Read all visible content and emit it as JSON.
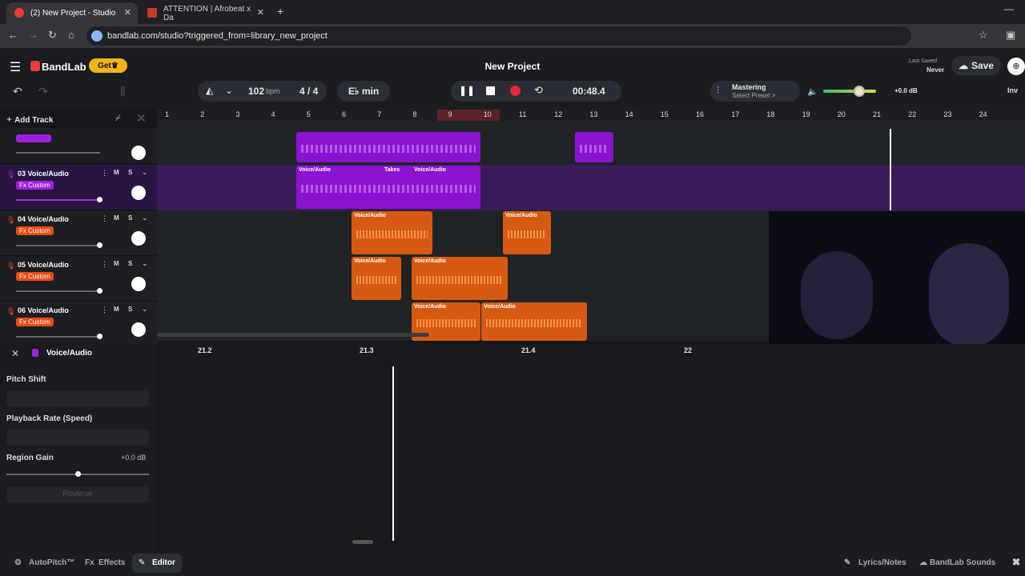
{
  "browser": {
    "tabs": [
      {
        "title": "(2) New Project - Studio"
      },
      {
        "title": "ATTENTION | Afrobeat x Da"
      }
    ],
    "url": "bandlab.com/studio?triggered_from=library_new_project"
  },
  "app": {
    "brand": "BandLab",
    "get_label": "Get",
    "project_title": "New Project",
    "last_saved_label": "Last Saved",
    "last_saved_value": "Never",
    "save_label": "Save",
    "bpm": "102",
    "bpm_unit": "bpm",
    "time_sig": "4 / 4",
    "key": "E♭ min",
    "time": "00:48.4",
    "mastering_label": "Mastering",
    "mastering_preset": "Select Preset >",
    "volume_db": "+0.0 dB",
    "add_track": "Add Track",
    "inv_label": "Inv"
  },
  "ruler": [
    "1",
    "2",
    "3",
    "4",
    "5",
    "6",
    "7",
    "8",
    "9",
    "10",
    "11",
    "12",
    "13",
    "14",
    "15",
    "16",
    "17",
    "18",
    "19",
    "20",
    "21",
    "22",
    "23",
    "24"
  ],
  "tracks": [
    {
      "name": "03 Voice/Audio",
      "fx": "Fx Custom"
    },
    {
      "name": "04 Voice/Audio",
      "fx": "Fx Custom"
    },
    {
      "name": "05 Voice/Audio",
      "fx": "Fx Custom"
    },
    {
      "name": "06 Voice/Audio",
      "fx": "Fx Custom"
    }
  ],
  "clip_label": "Voice/Audio",
  "takes_label": "Takes",
  "track_btn_m": "M",
  "track_btn_s": "S",
  "editor": {
    "title": "Voice/Audio",
    "pitch_shift": "Pitch Shift",
    "playback_rate": "Playback Rate (Speed)",
    "region_gain": "Region Gain",
    "region_gain_value": "+0.0 dB",
    "reverse": "Reverse",
    "ruler": [
      "21.2",
      "21.3",
      "21.4",
      "22"
    ]
  },
  "footer": {
    "autopitch": "AutoPitch™",
    "effects": "Effects",
    "editor": "Editor",
    "lyrics": "Lyrics/Notes",
    "sounds": "BandLab Sounds"
  }
}
